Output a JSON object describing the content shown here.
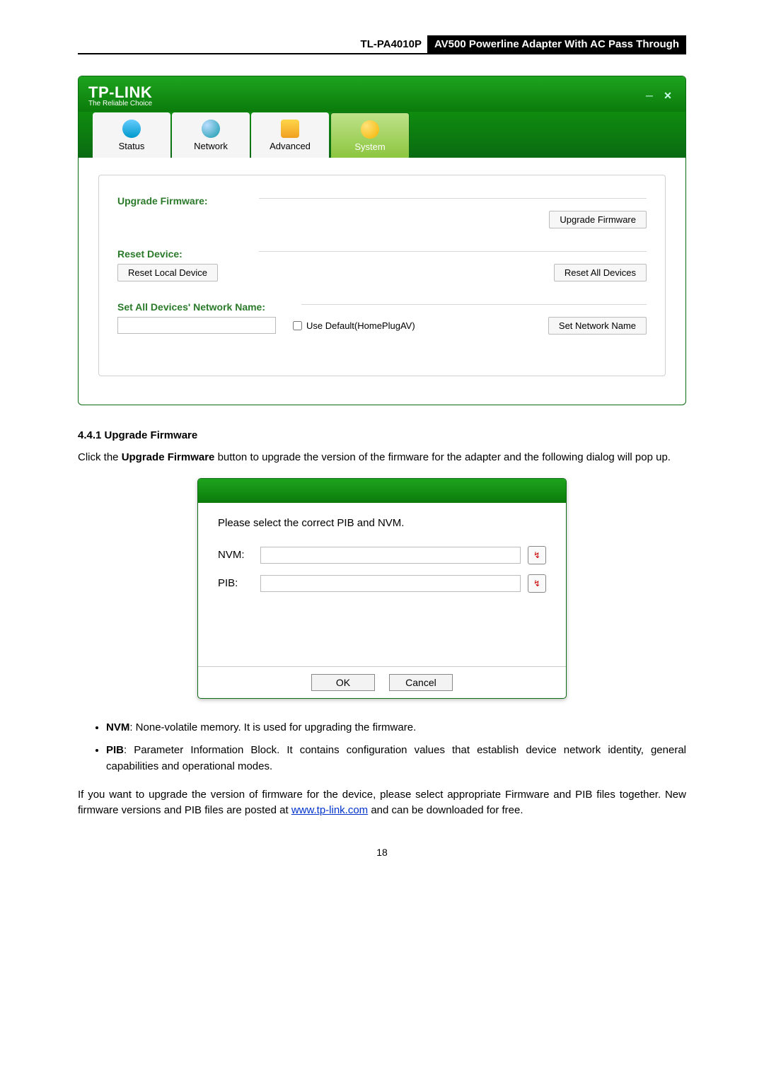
{
  "header": {
    "code": "TL-PA4010P",
    "title": "AV500 Powerline Adapter With AC Pass Through"
  },
  "app": {
    "brand": "TP-LINK",
    "tagline": "The Reliable Choice",
    "tabs": {
      "status": "Status",
      "network": "Network",
      "advanced": "Advanced",
      "system": "System"
    },
    "sections": {
      "upgrade_title": "Upgrade Firmware:",
      "upgrade_btn": "Upgrade Firmware",
      "reset_title": "Reset Device:",
      "reset_local_btn": "Reset Local Device",
      "reset_all_btn": "Reset All Devices",
      "netname_title": "Set All Devices' Network Name:",
      "use_default_label": "Use Default(HomePlugAV)",
      "set_name_btn": "Set Network Name"
    }
  },
  "doc": {
    "heading": "4.4.1 Upgrade Firmware",
    "para1_pre": "Click the ",
    "para1_bold": "Upgrade Firmware",
    "para1_post": " button to upgrade the version of the firmware for the adapter and the following dialog will pop up.",
    "bullets": {
      "nvm_bold": "NVM",
      "nvm_text": ": None-volatile memory. It is used for upgrading the firmware.",
      "pib_bold": "PIB",
      "pib_text": ": Parameter Information Block. It contains configuration values that establish device network identity, general capabilities and operational modes."
    },
    "para2_pre": "If you want to upgrade the version of firmware for the device, please select appropriate Firmware and PIB files together. New firmware versions and PIB files are posted at ",
    "para2_link": "www.tp-link.com",
    "para2_post": " and can be downloaded for free.",
    "page_number": "18"
  },
  "dialog": {
    "msg": "Please select the correct PIB and NVM.",
    "nvm_label": "NVM:",
    "pib_label": "PIB:",
    "ok": "OK",
    "cancel": "Cancel"
  }
}
